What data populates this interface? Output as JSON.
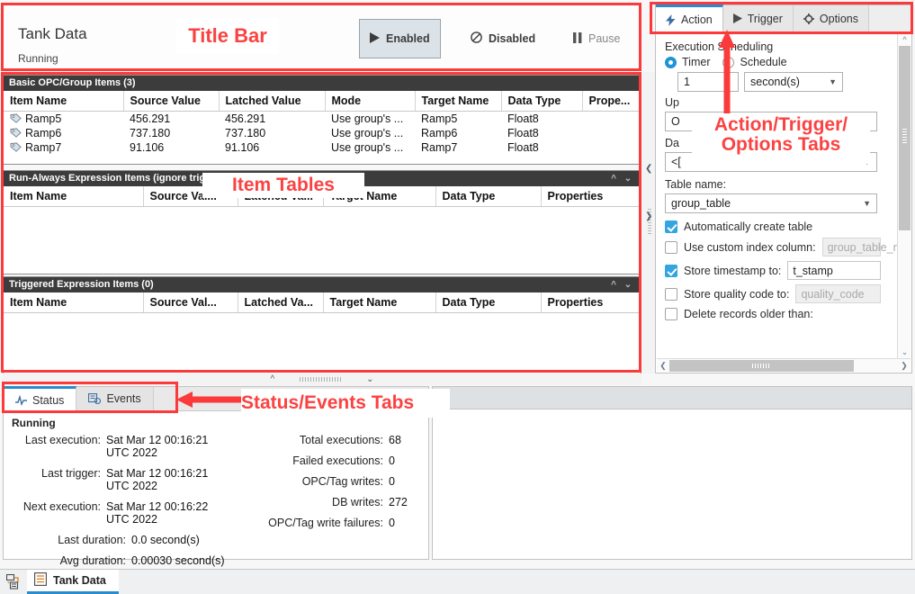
{
  "title_bar": {
    "name": "Tank Data",
    "state": "Running",
    "buttons": [
      {
        "id": "enabled",
        "label": "Enabled",
        "icon": "play-icon",
        "active": true
      },
      {
        "id": "disabled",
        "label": "Disabled",
        "icon": "no-entry-icon",
        "active": false
      },
      {
        "id": "pause",
        "label": "Pause",
        "icon": "pause-icon",
        "active": false
      }
    ]
  },
  "tables": {
    "basic": {
      "heading": "Basic OPC/Group Items",
      "count": "(3)",
      "columns": [
        "Item Name",
        "Source Value",
        "Latched Value",
        "Mode",
        "Target Name",
        "Data Type",
        "Prope..."
      ],
      "rows": [
        {
          "item_name": "Ramp5",
          "source_value": "456.291",
          "latched_value": "456.291",
          "mode": "Use group's ...",
          "target_name": "Ramp5",
          "data_type": "Float8",
          "properties": ""
        },
        {
          "item_name": "Ramp6",
          "source_value": "737.180",
          "latched_value": "737.180",
          "mode": "Use group's ...",
          "target_name": "Ramp6",
          "data_type": "Float8",
          "properties": ""
        },
        {
          "item_name": "Ramp7",
          "source_value": "91.106",
          "latched_value": "91.106",
          "mode": "Use group's ...",
          "target_name": "Ramp7",
          "data_type": "Float8",
          "properties": ""
        }
      ]
    },
    "run_always": {
      "heading": "Run-Always Expression Items (ignore trig",
      "count": "",
      "columns": [
        "Item Name",
        "Source Val...",
        "Latched Va...",
        "Target Name",
        "Data Type",
        "Properties"
      ],
      "rows": []
    },
    "triggered": {
      "heading": "Triggered Expression Items",
      "count": "(0)",
      "columns": [
        "Item Name",
        "Source Val...",
        "Latched Va...",
        "Target Name",
        "Data Type",
        "Properties"
      ],
      "rows": []
    }
  },
  "right_panel": {
    "tabs": [
      {
        "label": "Action",
        "icon": "lightning-icon",
        "active": true
      },
      {
        "label": "Trigger",
        "icon": "play-icon",
        "active": false
      },
      {
        "label": "Options",
        "icon": "gear-icon",
        "active": false
      }
    ],
    "execution_scheduling_label": "Execution Scheduling",
    "timer_label": "Timer",
    "schedule_label": "Schedule",
    "timer_selected": true,
    "interval_value": "1",
    "interval_unit": "second(s)",
    "update_label": "Up",
    "update_value": "O",
    "datasource_label": "Da",
    "datasource_value": "<[",
    "table_name_label": "Table name:",
    "table_name_value": "group_table",
    "auto_create_label": "Automatically create table",
    "auto_create_checked": true,
    "custom_index_label": "Use custom index column:",
    "custom_index_checked": false,
    "custom_index_placeholder": "group_table_nd",
    "store_timestamp_label": "Store timestamp to:",
    "store_timestamp_checked": true,
    "store_timestamp_value": "t_stamp",
    "store_quality_label": "Store quality code to:",
    "store_quality_checked": false,
    "store_quality_placeholder": "quality_code",
    "delete_records_label": "Delete records older than:",
    "delete_records_checked": false
  },
  "status_panel": {
    "tabs": [
      {
        "label": "Status",
        "icon": "pulse-icon",
        "active": true
      },
      {
        "label": "Events",
        "icon": "event-list-icon",
        "active": false
      }
    ],
    "running_label": "Running",
    "left_rows": [
      {
        "key": "Last execution:",
        "value": "Sat Mar 12 00:16:21 UTC 2022"
      },
      {
        "key": "Last trigger:",
        "value": "Sat Mar 12 00:16:21 UTC 2022"
      },
      {
        "key": "Next execution:",
        "value": "Sat Mar 12 00:16:22 UTC 2022"
      },
      {
        "key": "Last duration:",
        "value": "0.0 second(s)"
      },
      {
        "key": "Avg duration:",
        "value": "0.00030 second(s)"
      }
    ],
    "right_rows": [
      {
        "key": "Total executions:",
        "value": "68"
      },
      {
        "key": "Failed executions:",
        "value": "0"
      },
      {
        "key": "OPC/Tag writes:",
        "value": "0"
      },
      {
        "key": "DB writes:",
        "value": "272"
      },
      {
        "key": "OPC/Tag write failures:",
        "value": "0"
      }
    ]
  },
  "taskbar": {
    "window_icon": "document-icon",
    "window_label": "Tank Data"
  },
  "annotations": {
    "title_bar": "Title Bar",
    "item_tables": "Item Tables",
    "action_tabs": "Action/Trigger/\nOptions Tabs",
    "status_tabs": "Status/Events Tabs",
    "color": "#fb3b3b"
  }
}
